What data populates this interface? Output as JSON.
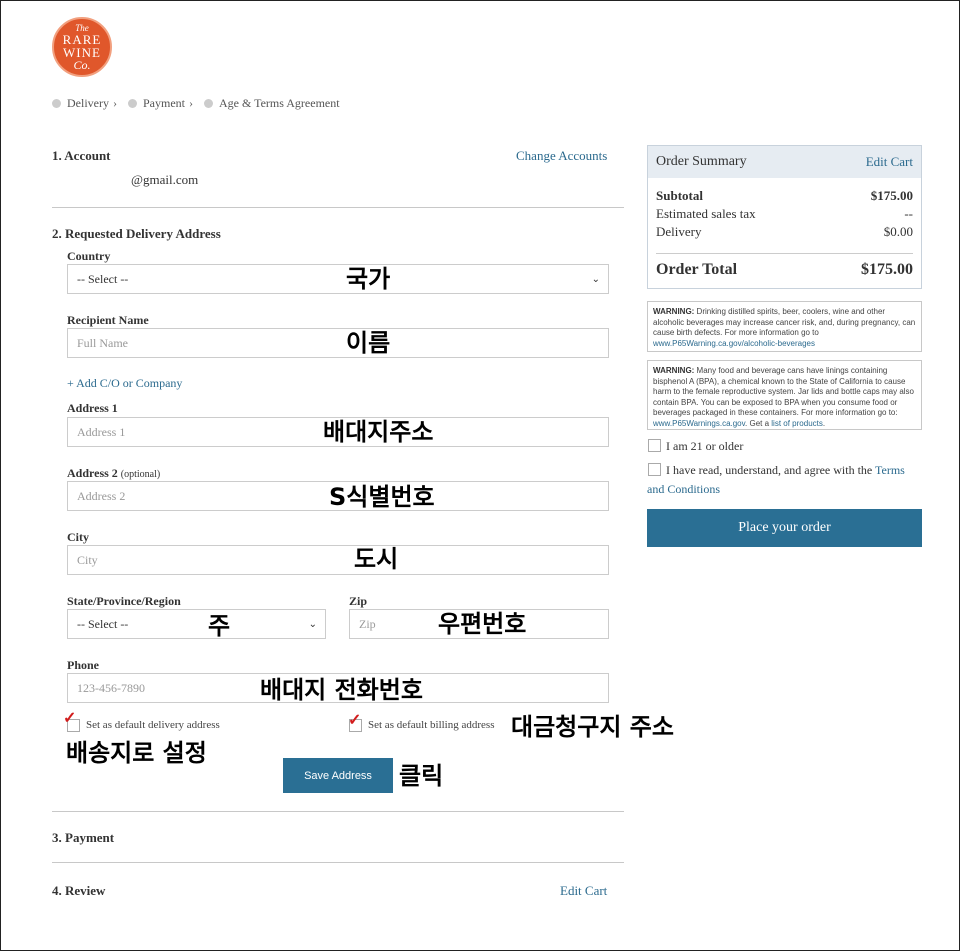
{
  "logo": {
    "line1": "The",
    "line2": "RARE",
    "line3": "WINE",
    "line4": "Co."
  },
  "breadcrumb": [
    "Delivery",
    "Payment",
    "Age & Terms Agreement"
  ],
  "account": {
    "title": "1. Account",
    "change_link": "Change Accounts",
    "email": "@gmail.com"
  },
  "delivery": {
    "title": "2. Requested Delivery Address",
    "country_label": "Country",
    "country_value": "-- Select --",
    "recipient_label": "Recipient Name",
    "recipient_placeholder": "Full Name",
    "add_co_link": "+ Add C/O or Company",
    "address1_label": "Address 1",
    "address1_placeholder": "Address 1",
    "address2_label": "Address 2",
    "address2_optional": "(optional)",
    "address2_placeholder": "Address 2",
    "city_label": "City",
    "city_placeholder": "City",
    "state_label": "State/Province/Region",
    "state_value": "-- Select --",
    "zip_label": "Zip",
    "zip_placeholder": "Zip",
    "phone_label": "Phone",
    "phone_placeholder": "123-456-7890",
    "default_delivery_label": "Set as default delivery address",
    "default_billing_label": "Set as default billing address",
    "save_button": "Save Address"
  },
  "payment": {
    "title": "3. Payment"
  },
  "review": {
    "title": "4. Review",
    "edit_link": "Edit Cart"
  },
  "summary": {
    "title": "Order Summary",
    "edit_link": "Edit Cart",
    "subtotal_label": "Subtotal",
    "subtotal_value": "$175.00",
    "tax_label": "Estimated sales tax",
    "tax_value": "--",
    "delivery_label": "Delivery",
    "delivery_value": "$0.00",
    "total_label": "Order Total",
    "total_value": "$175.00"
  },
  "warnings": {
    "w1_bold": "WARNING:",
    "w1_text": " Drinking distilled spirits, beer, coolers, wine and other alcoholic beverages may increase cancer risk, and, during pregnancy, can cause birth defects. For more information go to ",
    "w1_link": "www.P65Warning.ca.gov/alcoholic-beverages",
    "w2_bold": "WARNING:",
    "w2_text": " Many food and beverage cans have linings containing bisphenol A (BPA), a chemical known to the State of California to cause harm to the female reproductive system. Jar lids and bottle caps may also contain BPA. You can be exposed to BPA when you consume food or beverages packaged in these containers. For more information go to: ",
    "w2_link": "www.P65Warnings.ca.gov",
    "w2_text2": ". Get a ",
    "w2_link2": "list of products",
    "w2_end": "."
  },
  "agreement": {
    "age_label": "I am 21 or older",
    "terms_text": "I have read, understand, and agree with the ",
    "terms_link_a": "Terms",
    "terms_link_b": "and Conditions"
  },
  "place_order": "Place your order",
  "annotations": {
    "country": "국가",
    "name": "이름",
    "address1": "배대지주소",
    "address2": "S식별번호",
    "city": "도시",
    "state": "주",
    "zip": "우편번호",
    "phone": "배대지 전화번호",
    "billing": "대금청구지 주소",
    "default_delivery": "배송지로 설정",
    "click": "클릭"
  },
  "colors": {
    "accent": "#2a6f94",
    "logo": "#e0572b",
    "check": "#d21c1c"
  }
}
